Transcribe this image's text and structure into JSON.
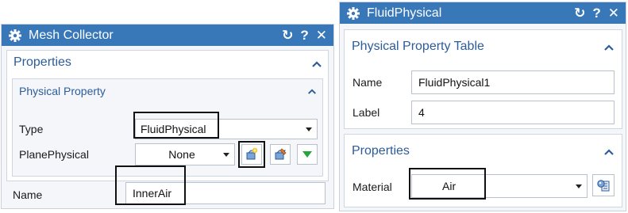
{
  "mesh_collector": {
    "title": "Mesh Collector",
    "properties_title": "Properties",
    "physical_property_title": "Physical Property",
    "type_label": "Type",
    "type_value": "FluidPhysical",
    "plane_label": "PlanePhysical",
    "plane_value": "None",
    "name_label": "Name",
    "name_value": "InnerAir"
  },
  "fluid_physical": {
    "title": "FluidPhysical",
    "table_title": "Physical Property Table",
    "name_label": "Name",
    "name_value": "FluidPhysical1",
    "label_label": "Label",
    "label_value": "4",
    "properties_title": "Properties",
    "material_label": "Material",
    "material_value": "Air"
  },
  "titlebar_buttons": {
    "reset": "↻",
    "help": "?",
    "close": "✕"
  },
  "colors": {
    "titlebar": "#3877b8",
    "section_text": "#2c5c9a",
    "green_arrow": "#22a83a"
  },
  "icons": {
    "gear": "gear-icon",
    "create_physical": "create-physical-icon",
    "edit_physical": "edit-physical-icon",
    "material_browser": "material-browser-icon"
  }
}
